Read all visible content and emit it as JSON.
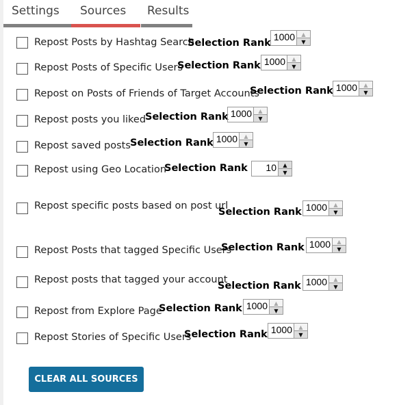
{
  "tabs": [
    {
      "label": "Settings",
      "color": "#808080"
    },
    {
      "label": "Sources",
      "color": "#d9534f",
      "active": true
    },
    {
      "label": "Results",
      "color": "#808080"
    }
  ],
  "rank_label": "Selection Rank",
  "sources": [
    {
      "label": "Repost Posts by Hashtag Search",
      "checked": false,
      "rank": "1000"
    },
    {
      "label": "Repost Posts of Specific Users",
      "checked": false,
      "rank": "1000"
    },
    {
      "label": "Repost on Posts of Friends of Target Accounts",
      "checked": false,
      "rank": "1000"
    },
    {
      "label": "Repost posts you liked",
      "checked": false,
      "rank": "1000"
    },
    {
      "label": "Repost saved posts",
      "checked": false,
      "rank": "1000"
    },
    {
      "label": "Repost using Geo Location",
      "checked": false,
      "rank": "10"
    },
    {
      "label": "Repost specific posts based on post url",
      "checked": false,
      "rank": "1000"
    },
    {
      "label": "Repost Posts that tagged Specific Users",
      "checked": false,
      "rank": "1000"
    },
    {
      "label": "Repost posts that tagged your account",
      "checked": false,
      "rank": "1000"
    },
    {
      "label": "Repost from Explore Page",
      "checked": false,
      "rank": "1000"
    },
    {
      "label": "Repost Stories of Specific Users",
      "checked": false,
      "rank": "1000"
    }
  ],
  "clear_button": "CLEAR ALL SOURCES",
  "button_color": "#146e9c"
}
